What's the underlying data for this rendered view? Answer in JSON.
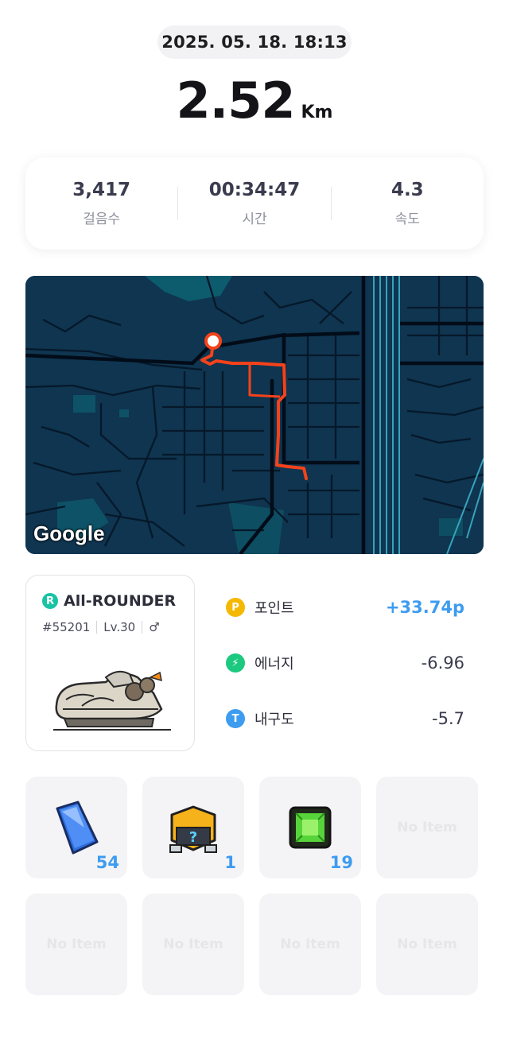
{
  "header": {
    "datetime": "2025. 05. 18. 18:13",
    "distance": "2.52",
    "distance_unit": "Km"
  },
  "stats": [
    {
      "value": "3,417",
      "label": "걸음수"
    },
    {
      "value": "00:34:47",
      "label": "시간"
    },
    {
      "value": "4.3",
      "label": "속도"
    }
  ],
  "map": {
    "attribution": "Google",
    "route_color": "#f5421a"
  },
  "sneaker": {
    "rarity_badge": "R",
    "name": "All-ROUNDER",
    "id": "#55201",
    "level": "Lv.30",
    "gender_icon": "♂"
  },
  "rewards": [
    {
      "icon_letter": "P",
      "icon": "point-icon",
      "color": "#f5b800",
      "label": "포인트",
      "value": "+33.74p",
      "positive": true
    },
    {
      "icon_letter": "⚡",
      "icon": "energy-icon",
      "color": "#1cc97f",
      "label": "에너지",
      "value": "-6.96",
      "positive": false
    },
    {
      "icon_letter": "T",
      "icon": "durability-icon",
      "color": "#3d9cf0",
      "label": "내구도",
      "value": "-5.7",
      "positive": false
    }
  ],
  "items": [
    {
      "icon": "blue-crystal-icon",
      "count": "54"
    },
    {
      "icon": "mystery-box-icon",
      "count": "1"
    },
    {
      "icon": "green-gem-icon",
      "count": "19"
    },
    {
      "empty_label": "No Item"
    },
    {
      "empty_label": "No Item"
    },
    {
      "empty_label": "No Item"
    },
    {
      "empty_label": "No Item"
    },
    {
      "empty_label": "No Item"
    }
  ]
}
